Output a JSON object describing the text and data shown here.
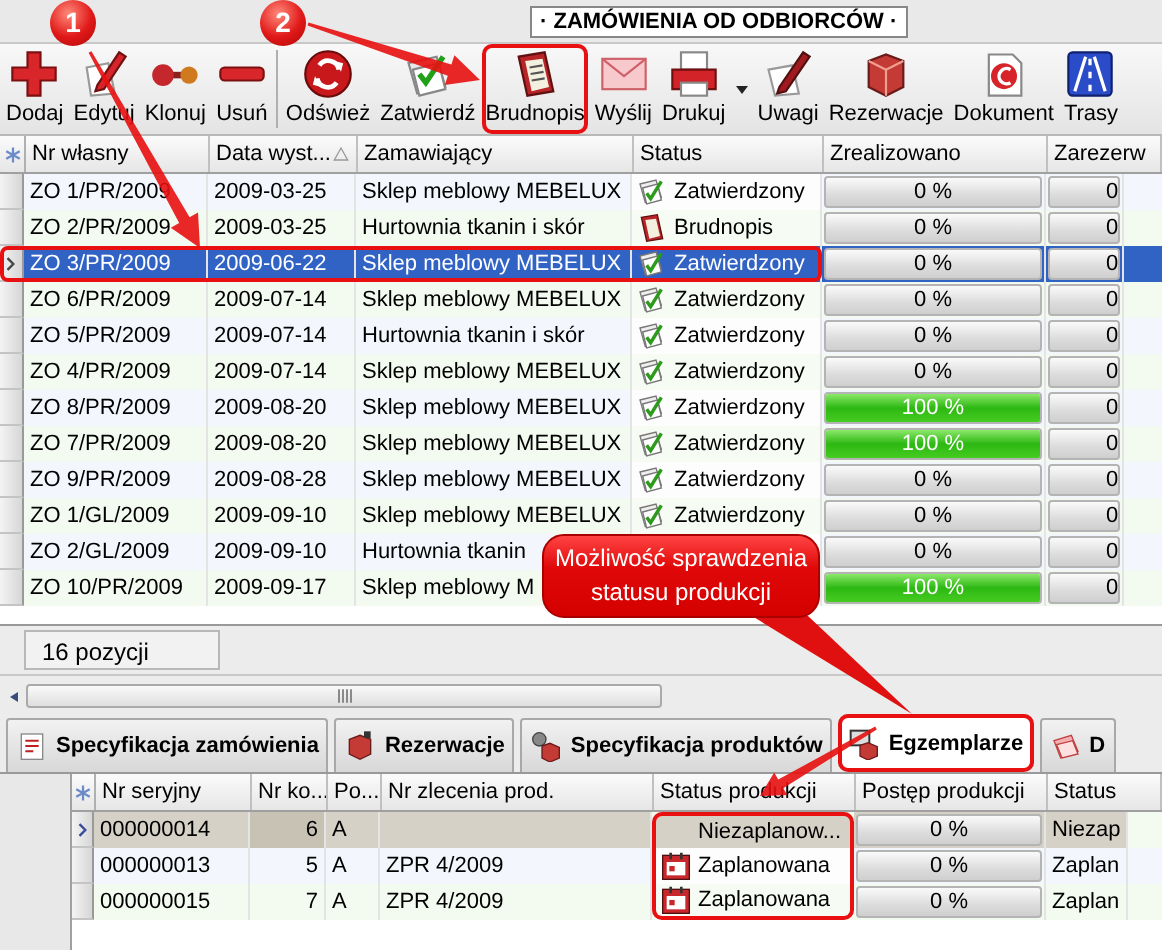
{
  "window": {
    "title": "· ZAMÓWIENIA OD ODBIORCÓW ·"
  },
  "toolbar": [
    {
      "label": "Dodaj",
      "highlighted": false,
      "dropdown": false
    },
    {
      "label": "Edytuj",
      "highlighted": false,
      "dropdown": false
    },
    {
      "label": "Klonuj",
      "highlighted": false,
      "dropdown": false
    },
    {
      "label": "Usuń",
      "highlighted": false,
      "dropdown": false
    },
    {
      "label": "Odśwież",
      "highlighted": false,
      "dropdown": false
    },
    {
      "label": "Zatwierdź",
      "highlighted": false,
      "dropdown": false
    },
    {
      "label": "Brudnopis",
      "highlighted": true,
      "dropdown": false
    },
    {
      "label": "Wyślij",
      "highlighted": false,
      "dropdown": false
    },
    {
      "label": "Drukuj",
      "highlighted": false,
      "dropdown": true
    },
    {
      "label": "Uwagi",
      "highlighted": false,
      "dropdown": false
    },
    {
      "label": "Rezerwacje",
      "highlighted": false,
      "dropdown": false
    },
    {
      "label": "Dokument",
      "highlighted": false,
      "dropdown": false
    },
    {
      "label": "Trasy",
      "highlighted": false,
      "dropdown": false
    }
  ],
  "orders": {
    "columns": [
      {
        "label": "Nr własny",
        "sorted": false
      },
      {
        "label": "Data wyst...",
        "sorted": true
      },
      {
        "label": "Zamawiający",
        "sorted": false
      },
      {
        "label": "Status",
        "sorted": false
      },
      {
        "label": "Zrealizowano",
        "sorted": false
      },
      {
        "label": "Zarezerw",
        "sorted": false
      }
    ],
    "rows": [
      {
        "number": "ZO 1/PR/2009",
        "date": "2009-03-25",
        "customer": "Sklep meblowy MEBELUX",
        "status": {
          "kind": "approved",
          "label": "Zatwierdzony"
        },
        "realized": {
          "text": "0 %",
          "level": 0
        },
        "reserved": {
          "text": "0",
          "level": 0
        },
        "selected": false,
        "highlighted": false
      },
      {
        "number": "ZO 2/PR/2009",
        "date": "2009-03-25",
        "customer": "Hurtownia tkanin i skór",
        "status": {
          "kind": "draft",
          "label": "Brudnopis"
        },
        "realized": {
          "text": "0 %",
          "level": 0
        },
        "reserved": {
          "text": "0",
          "level": 0
        },
        "selected": false,
        "highlighted": false
      },
      {
        "number": "ZO 3/PR/2009",
        "date": "2009-06-22",
        "customer": "Sklep meblowy MEBELUX",
        "status": {
          "kind": "approved",
          "label": "Zatwierdzony"
        },
        "realized": {
          "text": "0 %",
          "level": 0
        },
        "reserved": {
          "text": "0",
          "level": 0
        },
        "selected": true,
        "highlighted": true
      },
      {
        "number": "ZO 6/PR/2009",
        "date": "2009-07-14",
        "customer": "Sklep meblowy MEBELUX",
        "status": {
          "kind": "approved",
          "label": "Zatwierdzony"
        },
        "realized": {
          "text": "0 %",
          "level": 0
        },
        "reserved": {
          "text": "0",
          "level": 0
        },
        "selected": false,
        "highlighted": false
      },
      {
        "number": "ZO 5/PR/2009",
        "date": "2009-07-14",
        "customer": "Hurtownia tkanin i skór",
        "status": {
          "kind": "approved",
          "label": "Zatwierdzony"
        },
        "realized": {
          "text": "0 %",
          "level": 0
        },
        "reserved": {
          "text": "0",
          "level": 0
        },
        "selected": false,
        "highlighted": false
      },
      {
        "number": "ZO 4/PR/2009",
        "date": "2009-07-14",
        "customer": "Sklep meblowy MEBELUX",
        "status": {
          "kind": "approved",
          "label": "Zatwierdzony"
        },
        "realized": {
          "text": "0 %",
          "level": 0
        },
        "reserved": {
          "text": "0",
          "level": 0
        },
        "selected": false,
        "highlighted": false
      },
      {
        "number": "ZO 8/PR/2009",
        "date": "2009-08-20",
        "customer": "Sklep meblowy MEBELUX",
        "status": {
          "kind": "approved",
          "label": "Zatwierdzony"
        },
        "realized": {
          "text": "100 %",
          "level": 1
        },
        "reserved": {
          "text": "0",
          "level": 0
        },
        "selected": false,
        "highlighted": false
      },
      {
        "number": "ZO 7/PR/2009",
        "date": "2009-08-20",
        "customer": "Sklep meblowy MEBELUX",
        "status": {
          "kind": "approved",
          "label": "Zatwierdzony"
        },
        "realized": {
          "text": "100 %",
          "level": 1
        },
        "reserved": {
          "text": "0",
          "level": 0
        },
        "selected": false,
        "highlighted": false
      },
      {
        "number": "ZO 9/PR/2009",
        "date": "2009-08-28",
        "customer": "Sklep meblowy MEBELUX",
        "status": {
          "kind": "approved",
          "label": "Zatwierdzony"
        },
        "realized": {
          "text": "0 %",
          "level": 0
        },
        "reserved": {
          "text": "0",
          "level": 0
        },
        "selected": false,
        "highlighted": false
      },
      {
        "number": "ZO 1/GL/2009",
        "date": "2009-09-10",
        "customer": "Sklep meblowy MEBELUX",
        "status": {
          "kind": "approved",
          "label": "Zatwierdzony"
        },
        "realized": {
          "text": "0 %",
          "level": 0
        },
        "reserved": {
          "text": "0",
          "level": 0
        },
        "selected": false,
        "highlighted": false
      },
      {
        "number": "ZO 2/GL/2009",
        "date": "2009-09-10",
        "customer": "Hurtownia tkanin",
        "realized": {
          "text": "0 %",
          "level": 0
        },
        "reserved": {
          "text": "0",
          "level": 0
        },
        "selected": false,
        "highlighted": false
      },
      {
        "number": "ZO 10/PR/2009",
        "date": "2009-09-17",
        "customer": "Sklep meblowy M",
        "realized": {
          "text": "100 %",
          "level": 1
        },
        "reserved": {
          "text": "0",
          "level": 0
        },
        "selected": false,
        "highlighted": false
      }
    ]
  },
  "footer": {
    "count": "16 pozycji"
  },
  "tabs": [
    {
      "label": "Specyfikacja zamówienia",
      "selected": false,
      "highlighted": false
    },
    {
      "label": "Rezerwacje",
      "selected": false,
      "highlighted": false
    },
    {
      "label": "Specyfikacja produktów",
      "selected": false,
      "highlighted": false
    },
    {
      "label": "Egzemplarze",
      "selected": true,
      "highlighted": true
    },
    {
      "label": "D",
      "selected": false,
      "highlighted": false
    }
  ],
  "items": {
    "columns": [
      {
        "label": "Nr seryjny"
      },
      {
        "label": "Nr ko..."
      },
      {
        "label": "Po..."
      },
      {
        "label": "Nr zlecenia prod."
      },
      {
        "label": "Status produkcji"
      },
      {
        "label": "Postęp produkcji"
      },
      {
        "label": "Status"
      }
    ],
    "rows": [
      {
        "serial": "000000014",
        "number": "6",
        "position": "A",
        "production_status": {
          "kind": "unplanned",
          "label": "Niezaplanow...",
          "highlighted": true
        },
        "progress": {
          "text": "0 %",
          "level": 0
        },
        "status": "Niezap",
        "selected": true
      },
      {
        "serial": "000000013",
        "number": "5",
        "position": "A",
        "order": "ZPR 4/2009",
        "production_status": {
          "kind": "planned",
          "label": "Zaplanowana",
          "highlighted": true
        },
        "progress": {
          "text": "0 %",
          "level": 0
        },
        "status": "Zaplan",
        "selected": false
      },
      {
        "serial": "000000015",
        "number": "7",
        "position": "A",
        "order": "ZPR 4/2009",
        "production_status": {
          "kind": "planned",
          "label": "Zaplanowana",
          "highlighted": true
        },
        "progress": {
          "text": "0 %",
          "level": 0
        },
        "status": "Zaplan",
        "selected": false
      }
    ]
  },
  "annotations": {
    "markers": [
      {
        "label": "1"
      },
      {
        "label": "2"
      }
    ],
    "callout": "Możliwość sprawdzenia statusu produkcji"
  }
}
